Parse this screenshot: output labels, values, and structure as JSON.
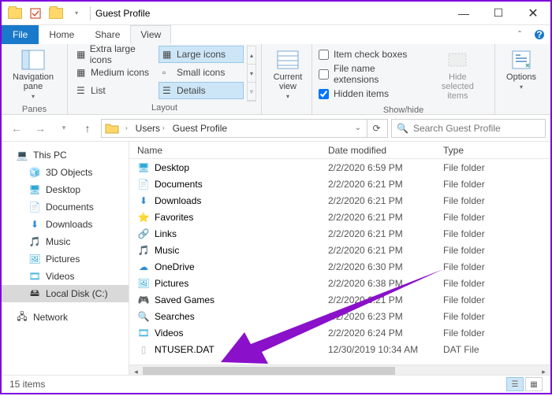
{
  "window": {
    "title": "Guest Profile"
  },
  "tabs": {
    "file": "File",
    "home": "Home",
    "share": "Share",
    "view": "View"
  },
  "ribbon": {
    "panes": {
      "btn": "Navigation\npane",
      "label": "Panes"
    },
    "layout": {
      "items": [
        "Extra large icons",
        "Large icons",
        "Medium icons",
        "Small icons",
        "List",
        "Details"
      ],
      "label": "Layout"
    },
    "current": {
      "btn": "Current\nview"
    },
    "showhide": {
      "chk1": "Item check boxes",
      "chk2": "File name extensions",
      "chk3": "Hidden items",
      "hidebtn": "Hide selected\nitems",
      "label": "Show/hide"
    },
    "options": {
      "btn": "Options"
    }
  },
  "address": {
    "crumbs": [
      "Users",
      "Guest Profile"
    ],
    "search_placeholder": "Search Guest Profile"
  },
  "nav": {
    "thispc": "This PC",
    "items": [
      "3D Objects",
      "Desktop",
      "Documents",
      "Downloads",
      "Music",
      "Pictures",
      "Videos",
      "Local Disk (C:)"
    ],
    "network": "Network"
  },
  "columns": {
    "name": "Name",
    "date": "Date modified",
    "type": "Type"
  },
  "rows": [
    {
      "name": "Desktop",
      "date": "2/2/2020 6:59 PM",
      "type": "File folder",
      "icon": "desktop"
    },
    {
      "name": "Documents",
      "date": "2/2/2020 6:21 PM",
      "type": "File folder",
      "icon": "doc"
    },
    {
      "name": "Downloads",
      "date": "2/2/2020 6:21 PM",
      "type": "File folder",
      "icon": "down"
    },
    {
      "name": "Favorites",
      "date": "2/2/2020 6:21 PM",
      "type": "File folder",
      "icon": "star"
    },
    {
      "name": "Links",
      "date": "2/2/2020 6:21 PM",
      "type": "File folder",
      "icon": "link"
    },
    {
      "name": "Music",
      "date": "2/2/2020 6:21 PM",
      "type": "File folder",
      "icon": "music"
    },
    {
      "name": "OneDrive",
      "date": "2/2/2020 6:30 PM",
      "type": "File folder",
      "icon": "cloud"
    },
    {
      "name": "Pictures",
      "date": "2/2/2020 6:38 PM",
      "type": "File folder",
      "icon": "pic"
    },
    {
      "name": "Saved Games",
      "date": "2/2/2020 6:21 PM",
      "type": "File folder",
      "icon": "game"
    },
    {
      "name": "Searches",
      "date": "2/2/2020 6:23 PM",
      "type": "File folder",
      "icon": "search"
    },
    {
      "name": "Videos",
      "date": "2/2/2020 6:24 PM",
      "type": "File folder",
      "icon": "video"
    },
    {
      "name": "NTUSER.DAT",
      "date": "12/30/2019 10:34 AM",
      "type": "DAT File",
      "icon": "file"
    }
  ],
  "status": {
    "count": "15 items"
  }
}
